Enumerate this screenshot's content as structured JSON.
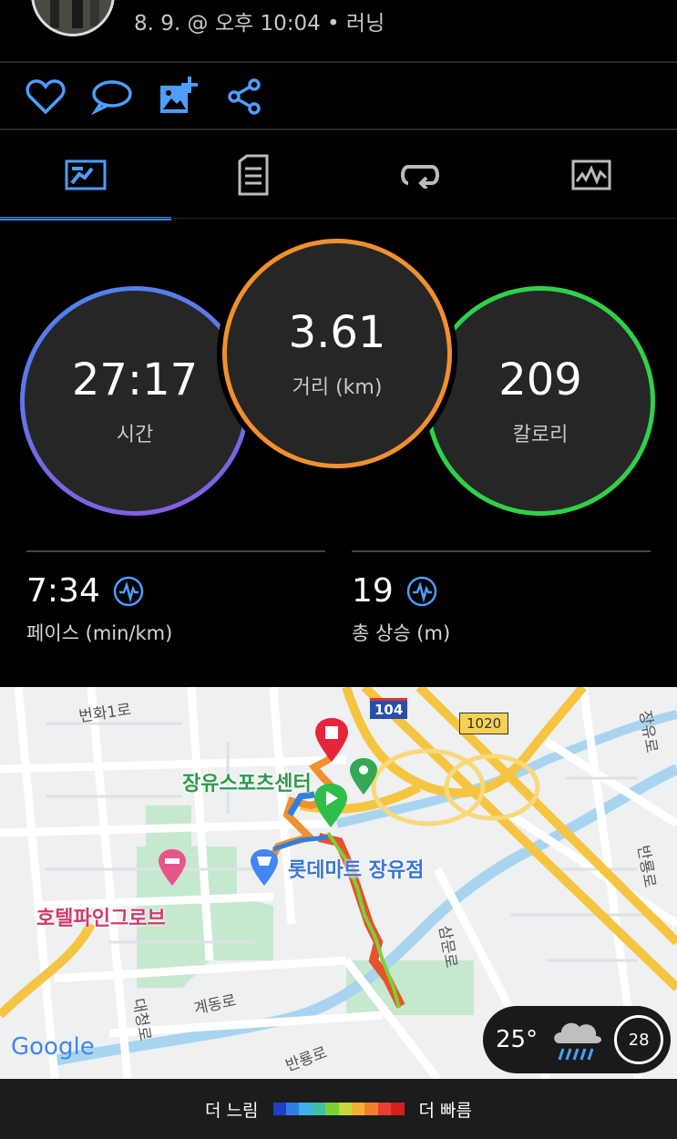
{
  "header": {
    "date_text": "8. 9. @ 오후 10:04 • 러닝"
  },
  "actions": {
    "like": "heart-icon",
    "comment": "comment-icon",
    "add_photo": "add-photo-icon",
    "share": "share-icon"
  },
  "tabs": [
    {
      "name": "summary",
      "icon": "stats-icon",
      "active": true
    },
    {
      "name": "details",
      "icon": "document-icon",
      "active": false
    },
    {
      "name": "laps",
      "icon": "laps-icon",
      "active": false
    },
    {
      "name": "charts",
      "icon": "chart-icon",
      "active": false
    }
  ],
  "metrics": {
    "time": {
      "value": "27:17",
      "label": "시간",
      "color_start": "#4a86f0",
      "color_end": "#8a5ae0"
    },
    "distance": {
      "value": "3.61",
      "label": "거리 (km)",
      "color": "#f0902e"
    },
    "calories": {
      "value": "209",
      "label": "칼로리",
      "color": "#2ed24a"
    }
  },
  "stats": {
    "pace": {
      "value": "7:34",
      "label": "페이스 (min/km)"
    },
    "ascent": {
      "value": "19",
      "label": "총 상승 (m)"
    }
  },
  "map": {
    "labels": {
      "road1": "번화1로",
      "sports_center": "장유스포츠센터",
      "mart": "롯데마트 장유점",
      "hotel": "호텔파인그로브",
      "road_gyedong": "계동로",
      "road_daecheong": "대청로",
      "road_banryong": "반룡로",
      "road_sammun": "삼문로",
      "road_jangyu": "장유로",
      "road_banryong2": "반룡로",
      "highway_104": "104",
      "highway_1020": "1020",
      "google": "Google"
    },
    "weather": {
      "temp": "25°",
      "icon": "rain-cloud-icon",
      "humidity": "28"
    }
  },
  "legend": {
    "slow": "더 느림",
    "fast": "더 빠름",
    "colors": [
      "#1f3fc8",
      "#2f7fe0",
      "#3fb0e8",
      "#40c0a0",
      "#7ccf3a",
      "#c8d83a",
      "#f0b030",
      "#f08030",
      "#e84030",
      "#d02020"
    ]
  }
}
